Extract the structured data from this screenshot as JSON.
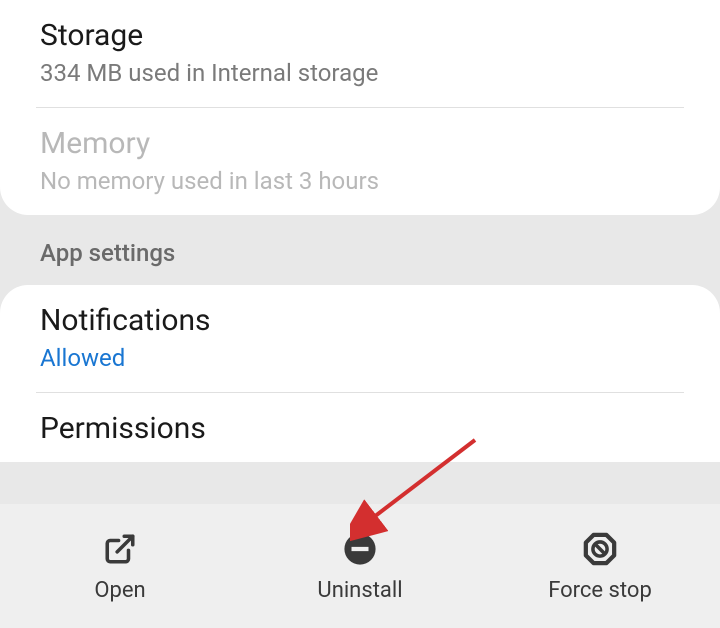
{
  "usage": {
    "storage": {
      "title": "Storage",
      "subtitle": "334 MB used in Internal storage"
    },
    "memory": {
      "title": "Memory",
      "subtitle": "No memory used in last 3 hours"
    }
  },
  "section_header": "App settings",
  "settings": {
    "notifications": {
      "title": "Notifications",
      "status": "Allowed"
    },
    "permissions": {
      "title": "Permissions"
    }
  },
  "actions": {
    "open": "Open",
    "uninstall": "Uninstall",
    "force_stop": "Force stop"
  }
}
